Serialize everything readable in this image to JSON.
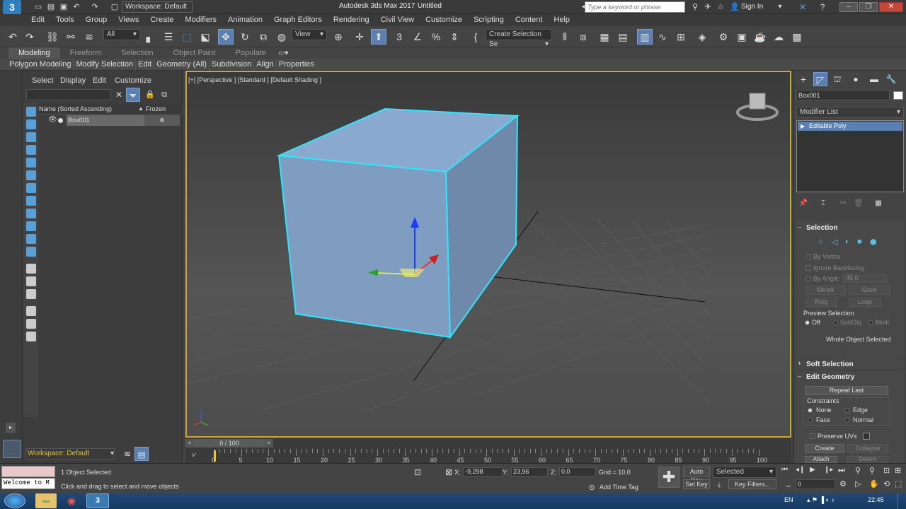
{
  "titlebar": {
    "workspace": "Workspace: Default",
    "title": "Autodesk 3ds Max 2017",
    "doc": "Untitled",
    "search_placeholder": "Type a keyword or phrase",
    "signin": "Sign In"
  },
  "menu": [
    "Edit",
    "Tools",
    "Group",
    "Views",
    "Create",
    "Modifiers",
    "Animation",
    "Graph Editors",
    "Rendering",
    "Civil View",
    "Customize",
    "Scripting",
    "Content",
    "Help"
  ],
  "toolbar": {
    "filter": "All",
    "refcoord": "View",
    "selection_set": "Create Selection Se"
  },
  "ribbon": {
    "tabs": [
      "Modeling",
      "Freeform",
      "Selection",
      "Object Paint",
      "Populate"
    ],
    "subtabs": [
      "Polygon Modeling",
      "Modify Selection",
      "Edit",
      "Geometry (All)",
      "Subdivision",
      "Align",
      "Properties"
    ]
  },
  "scene": {
    "menu": [
      "Select",
      "Display",
      "Edit",
      "Customize"
    ],
    "col_name": "Name (Sorted Ascending)",
    "col_frozen": "Frozen",
    "object": "Box001",
    "workspace": "Workspace: Default"
  },
  "viewport": {
    "label": "[+] [Perspective ] [Standard ] [Default Shading ]"
  },
  "cmd": {
    "object_name": "Box001",
    "modifier_list": "Modifier List",
    "stack_item": "Editable Poly",
    "selection_title": "Selection",
    "by_vertex": "By Vertex",
    "ignore_backfacing": "Ignore Backfacing",
    "by_angle": "By Angle:",
    "angle_value": "45,0",
    "shrink": "Shrink",
    "grow": "Grow",
    "ring": "Ring",
    "loop": "Loop",
    "preview_selection": "Preview Selection",
    "preview_off": "Off",
    "preview_subobj": "SubObj",
    "preview_multi": "Multi",
    "whole_selected": "Whole Object Selected",
    "soft_selection": "Soft Selection",
    "edit_geometry": "Edit Geometry",
    "repeat_last": "Repeat Last",
    "constraints": "Constraints",
    "c_none": "None",
    "c_edge": "Edge",
    "c_face": "Face",
    "c_normal": "Normal",
    "preserve_uvs": "Preserve UVs",
    "create": "Create",
    "collapse": "Collapse",
    "attach": "Attach",
    "detach": "Detach"
  },
  "timeline": {
    "frame": "0 / 100",
    "ticks": [
      "0",
      "5",
      "10",
      "15",
      "20",
      "25",
      "30",
      "35",
      "40",
      "45",
      "50",
      "55",
      "60",
      "65",
      "70",
      "75",
      "80",
      "85",
      "90",
      "95",
      "100"
    ]
  },
  "status": {
    "maxscript": "Welcome to M",
    "selected": "1 Object Selected",
    "prompt": "Click and drag to select and move objects",
    "x_label": "X:",
    "x_val": "-9,298",
    "y_label": "Y:",
    "y_val": "23,96",
    "z_label": "Z:",
    "z_val": "0,0",
    "grid": "Grid = 10,0",
    "add_time_tag": "Add Time Tag",
    "auto_key": "Auto Key",
    "set_key": "Set Key",
    "selected_dd": "Selected",
    "key_filters": "Key Filters...",
    "frame_field": "0"
  },
  "taskbar": {
    "lang": "EN",
    "clock": "22:45"
  }
}
